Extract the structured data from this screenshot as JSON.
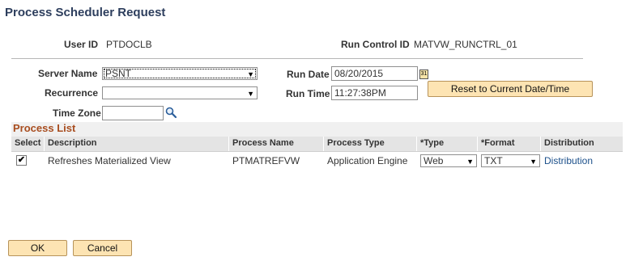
{
  "page": {
    "title": "Process Scheduler Request"
  },
  "header": {
    "user_id_label": "User ID",
    "user_id_value": "PTDOCLB",
    "run_control_label": "Run Control ID",
    "run_control_value": "MATVW_RUNCTRL_01"
  },
  "form": {
    "server_name_label": "Server Name",
    "server_name_value": "PSNT",
    "recurrence_label": "Recurrence",
    "recurrence_value": "",
    "time_zone_label": "Time Zone",
    "time_zone_value": "",
    "run_date_label": "Run Date",
    "run_date_value": "08/20/2015",
    "run_time_label": "Run Time",
    "run_time_value": "11:27:38PM",
    "reset_button_label": "Reset to Current Date/Time"
  },
  "process_list": {
    "title": "Process List",
    "columns": [
      "Select",
      "Description",
      "Process Name",
      "Process Type",
      "*Type",
      "*Format",
      "Distribution"
    ],
    "rows": [
      {
        "selected": true,
        "description": "Refreshes Materialized View",
        "process_name": "PTMATREFVW",
        "process_type": "Application Engine",
        "type": "Web",
        "format": "TXT",
        "distribution": "Distribution"
      }
    ]
  },
  "footer": {
    "ok_label": "OK",
    "cancel_label": "Cancel"
  },
  "icons": {
    "calendar": "calendar-icon",
    "lookup": "magnifier-icon",
    "dropdown": "chevron-down-icon",
    "check": "checkmark-icon"
  },
  "colors": {
    "title": "#2d3e5d",
    "section_title": "#a84d1f",
    "button_bg": "#fde4b3",
    "link": "#1b4f8a"
  }
}
